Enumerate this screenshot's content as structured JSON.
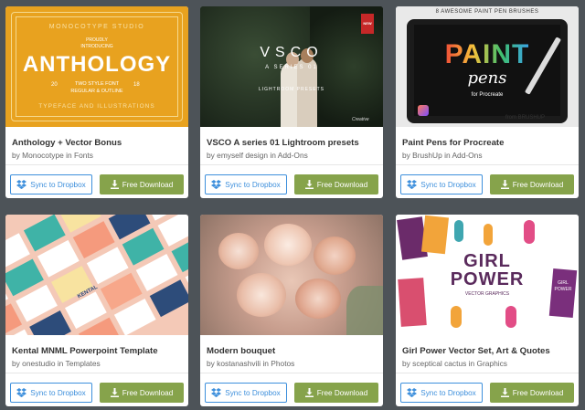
{
  "buttons": {
    "sync_label": "Sync to Dropbox",
    "download_label": "Free Download"
  },
  "colors": {
    "page_bg": "#4d5358",
    "sync_blue": "#3d8fdc",
    "download_green": "#86a34b"
  },
  "cards": [
    {
      "title": "Anthology + Vector Bonus",
      "byline": "by Monocotype in Fonts",
      "preview": {
        "top_text": "MONOCOTYPE STUDIO",
        "sub1": "PROUDLY",
        "sub2": "INTRODUCING",
        "headline": "ANTHOLOGY",
        "num_left": "20",
        "num_right": "18",
        "tagline1": "TWO STYLE FONT",
        "tagline2": "REGULAR & OUTLINE",
        "bottom_text": "TYPEFACE AND ILLUSTRATIONS"
      }
    },
    {
      "title": "VSCO A series 01 Lightroom presets",
      "byline": "by emyself design in Add-Ons",
      "preview": {
        "badge": "NEW",
        "headline": "VSCO",
        "subtitle": "A SERIES 01",
        "caption": "LIGHTROOM PRESETS",
        "signature": "Creative"
      }
    },
    {
      "title": "Paint Pens for Procreate",
      "byline": "by BrushUp in Add-Ons",
      "preview": {
        "banner": "8 AWESOME PAINT PEN BRUSHES",
        "headline": "PAINT",
        "script": "pens",
        "caption": "for Procreate",
        "credit": "from BRUSHUP"
      }
    },
    {
      "title": "Kental MNML Powerpoint Template",
      "byline": "by onestudio in Templates",
      "preview": {
        "slide_label": "KENTAL"
      }
    },
    {
      "title": "Modern bouquet",
      "byline": "by kostanashvili in Photos",
      "preview": {}
    },
    {
      "title": "Girl Power Vector Set, Art & Quotes",
      "byline": "by sceptical cactus in Graphics",
      "preview": {
        "line1": "GIRL",
        "line2": "POWER",
        "caption": "VECTOR GRAPHICS",
        "quote": "GIRL POWER"
      }
    }
  ]
}
